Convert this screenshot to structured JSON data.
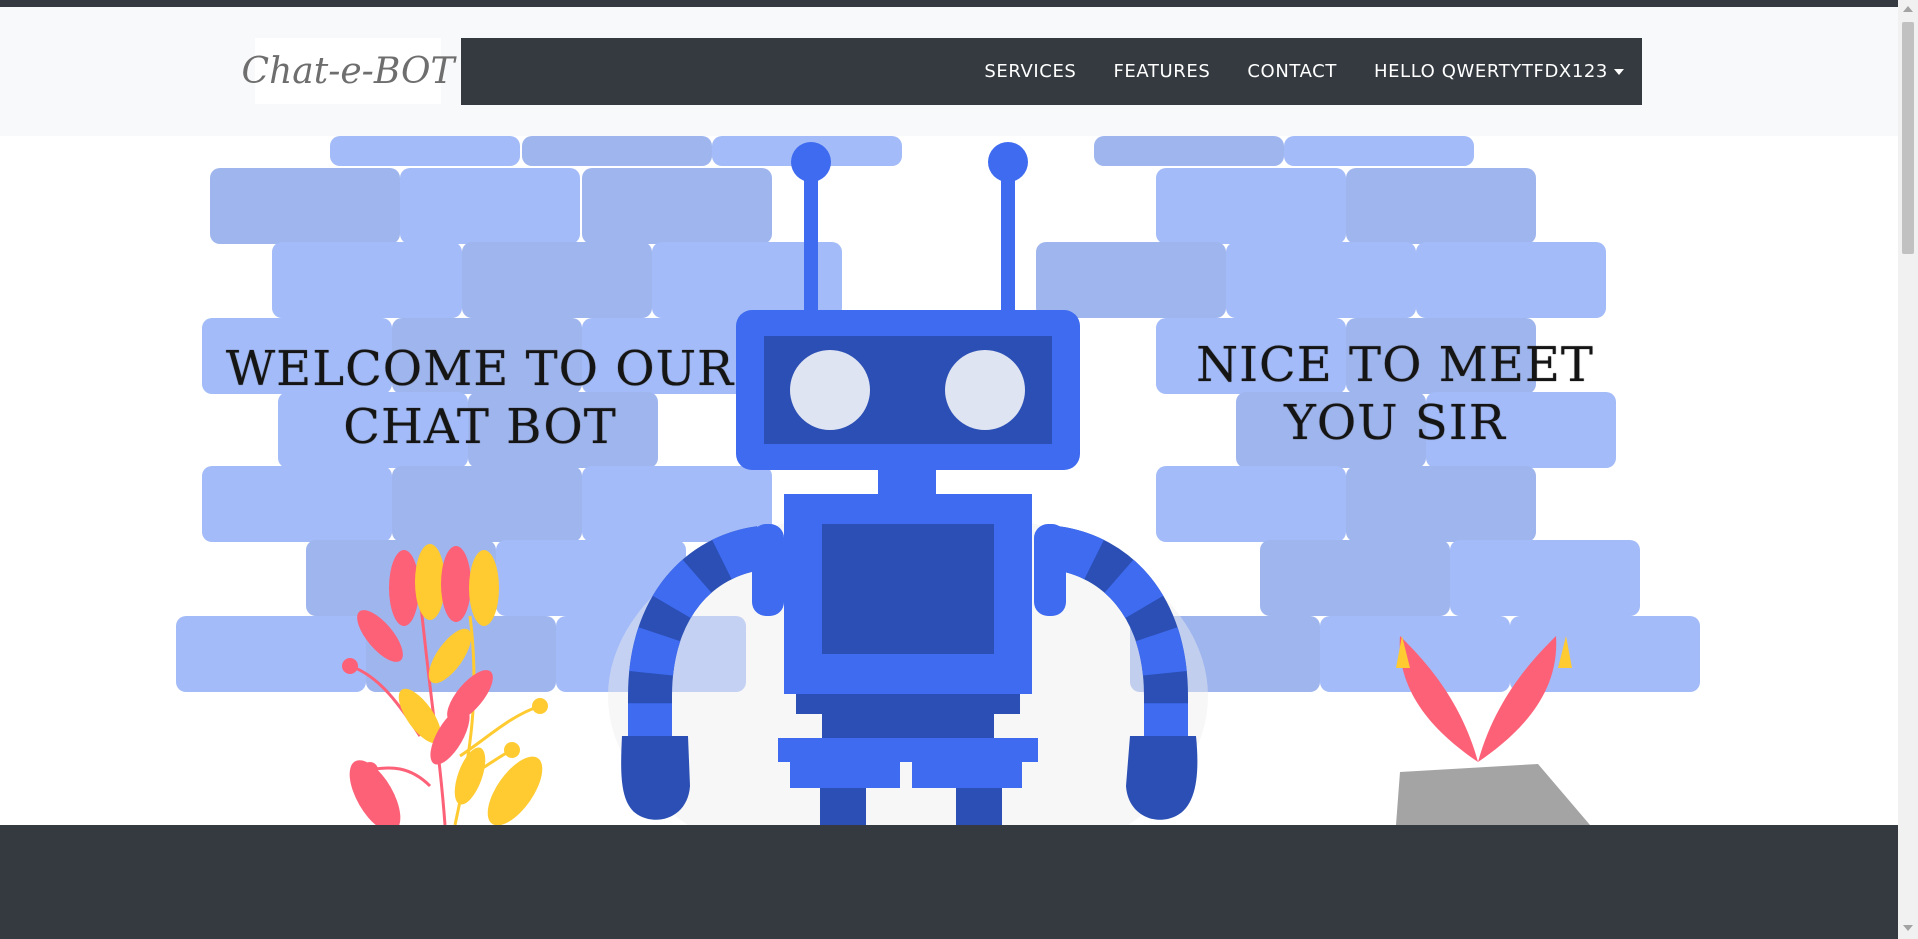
{
  "logo": {
    "text": "Chat-e-BOT"
  },
  "nav": {
    "items": [
      "SERVICES",
      "FEATURES",
      "CONTACT"
    ],
    "user_menu": "HELLO QWERTYTFDX123"
  },
  "hero": {
    "welcome_line1": "WELCOME TO OUR",
    "welcome_line2": "CHAT BOT",
    "nice_line1": "NICE TO MEET",
    "nice_line2": "YOU SIR"
  },
  "colors": {
    "navbar": "#343a40",
    "brick_light": "#a3bbf8",
    "brick_dark": "#9fb5ee",
    "robot_blue": "#3e6bf0",
    "robot_dark": "#2b4fb4",
    "eye": "#dfe4f3",
    "petal_pink": "#fd6178",
    "petal_yellow": "#ffcb31"
  }
}
